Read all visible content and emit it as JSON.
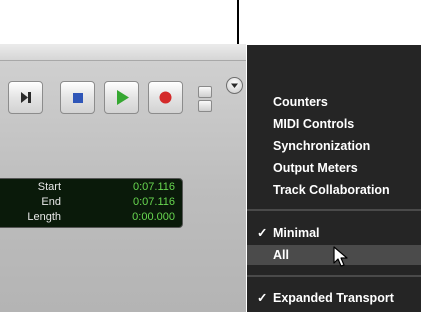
{
  "transport": {
    "counters": [
      {
        "label": "Start",
        "value": "0:07.116"
      },
      {
        "label": "End",
        "value": "0:07.116"
      },
      {
        "label": "Length",
        "value": "0:00.000"
      }
    ]
  },
  "menu": {
    "group1": [
      "Counters",
      "MIDI Controls",
      "Synchronization",
      "Output Meters",
      "Track Collaboration"
    ],
    "group2": [
      {
        "label": "Minimal",
        "checked": true
      },
      {
        "label": "All",
        "checked": false,
        "highlighted": true
      }
    ],
    "group3": [
      {
        "label": "Expanded Transport",
        "checked": true
      }
    ],
    "check_glyph": "✓"
  },
  "colors": {
    "menu_bg": "#252525",
    "menu_highlight": "#4b4b4b",
    "counter_green": "#68d850",
    "play_green": "#36a832",
    "record_red": "#d42a2a",
    "stop_blue": "#2f56b8"
  }
}
